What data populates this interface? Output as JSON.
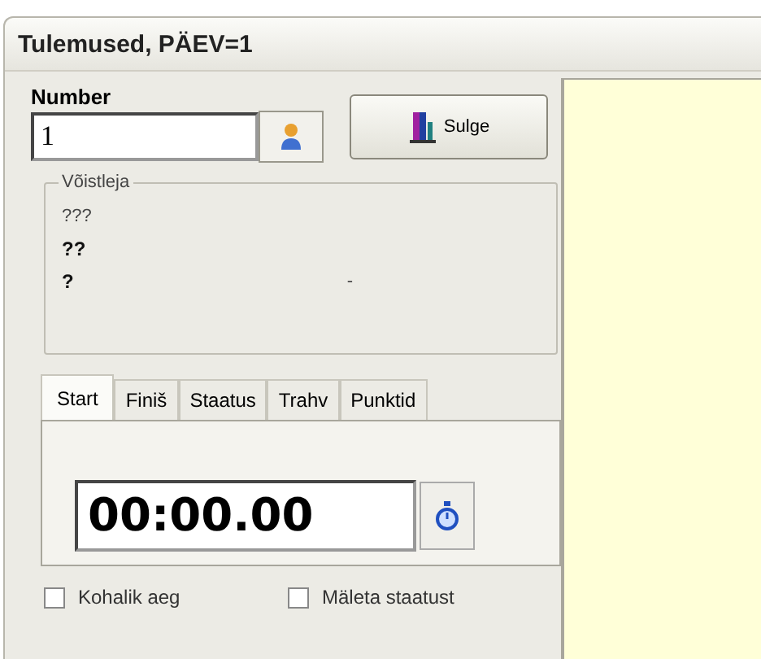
{
  "window": {
    "title": "Tulemused, PÄEV=1"
  },
  "number": {
    "label": "Number",
    "value": "1"
  },
  "close_button": {
    "label": "Sulge"
  },
  "competitor": {
    "title": "Võistleja",
    "lines": [
      {
        "text": "???",
        "bold": false
      },
      {
        "text": "??",
        "bold": true
      },
      {
        "text": "?",
        "bold": true
      }
    ],
    "mark": "-"
  },
  "tabs": [
    {
      "label": "Start",
      "selected": true
    },
    {
      "label": "Finiš",
      "selected": false
    },
    {
      "label": "Staatus",
      "selected": false
    },
    {
      "label": "Trahv",
      "selected": false
    },
    {
      "label": "Punktid",
      "selected": false
    }
  ],
  "time": {
    "value": "00:00.00"
  },
  "checkboxes": [
    {
      "label": "Kohalik aeg",
      "checked": false
    },
    {
      "label": "Mäleta staatust",
      "checked": false
    }
  ]
}
